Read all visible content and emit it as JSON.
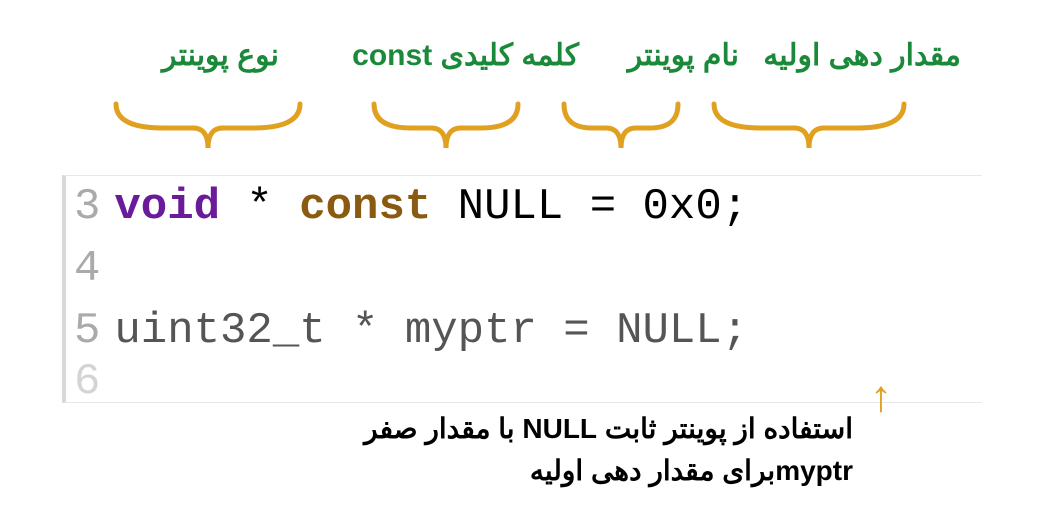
{
  "labels": {
    "initial_value": "مقدار دهی اولیه",
    "pointer_name": "نام پوینتر",
    "const_keyword": "کلمه کلیدی const",
    "pointer_type": "نوع پوینتر"
  },
  "code": {
    "lines": [
      {
        "num": "3",
        "segments": [
          {
            "type": "kw-type",
            "text": "void"
          },
          {
            "type": "plain",
            "text": " * "
          },
          {
            "type": "kw-const",
            "text": "const"
          },
          {
            "type": "plain",
            "text": " NULL = 0x0;"
          }
        ]
      },
      {
        "num": "4",
        "segments": []
      },
      {
        "num": "5",
        "segments": [
          {
            "type": "plain",
            "text": "uint32_t * myptr = NULL;"
          }
        ]
      }
    ],
    "partial_line_num": "6"
  },
  "description": {
    "line1_rtl_pre": "استفاده از پوینتر ثابت ",
    "line1_ltr_mid": "NULL",
    "line1_rtl_post": " با مقدار صفر",
    "line2_rtl_pre": "برای مقدار دهی اولیه ",
    "line2_ltr": "myptr"
  },
  "colors": {
    "label_green": "#1a8a3a",
    "brace_yellow": "#e0a020"
  }
}
